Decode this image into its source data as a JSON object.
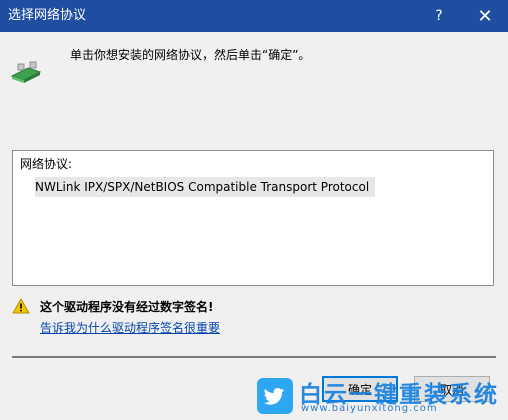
{
  "window": {
    "title": "选择网络协议",
    "help_glyph": "?",
    "close_glyph": "✕"
  },
  "instruction": "单击你想安装的网络协议，然后单击“确定”。",
  "protocol_list": {
    "label": "网络协议:",
    "items": [
      "NWLink IPX/SPX/NetBIOS Compatible Transport Protocol"
    ]
  },
  "warning": {
    "text": "这个驱动程序没有经过数字签名!",
    "link": "告诉我为什么驱动程序签名很重要"
  },
  "buttons": {
    "ok": "确定",
    "cancel": "取消"
  },
  "watermark": {
    "title": "白云一键重装系统",
    "url": "www.baiyunxitong.com"
  },
  "colors": {
    "titlebar": "#1f4ea1",
    "link": "#0645ad",
    "accent": "#0078d7",
    "watermark": "#1680e0"
  },
  "icons": [
    "network-protocol-icon",
    "warning-icon",
    "help-icon",
    "close-icon",
    "twitter-bird-logo-icon"
  ]
}
